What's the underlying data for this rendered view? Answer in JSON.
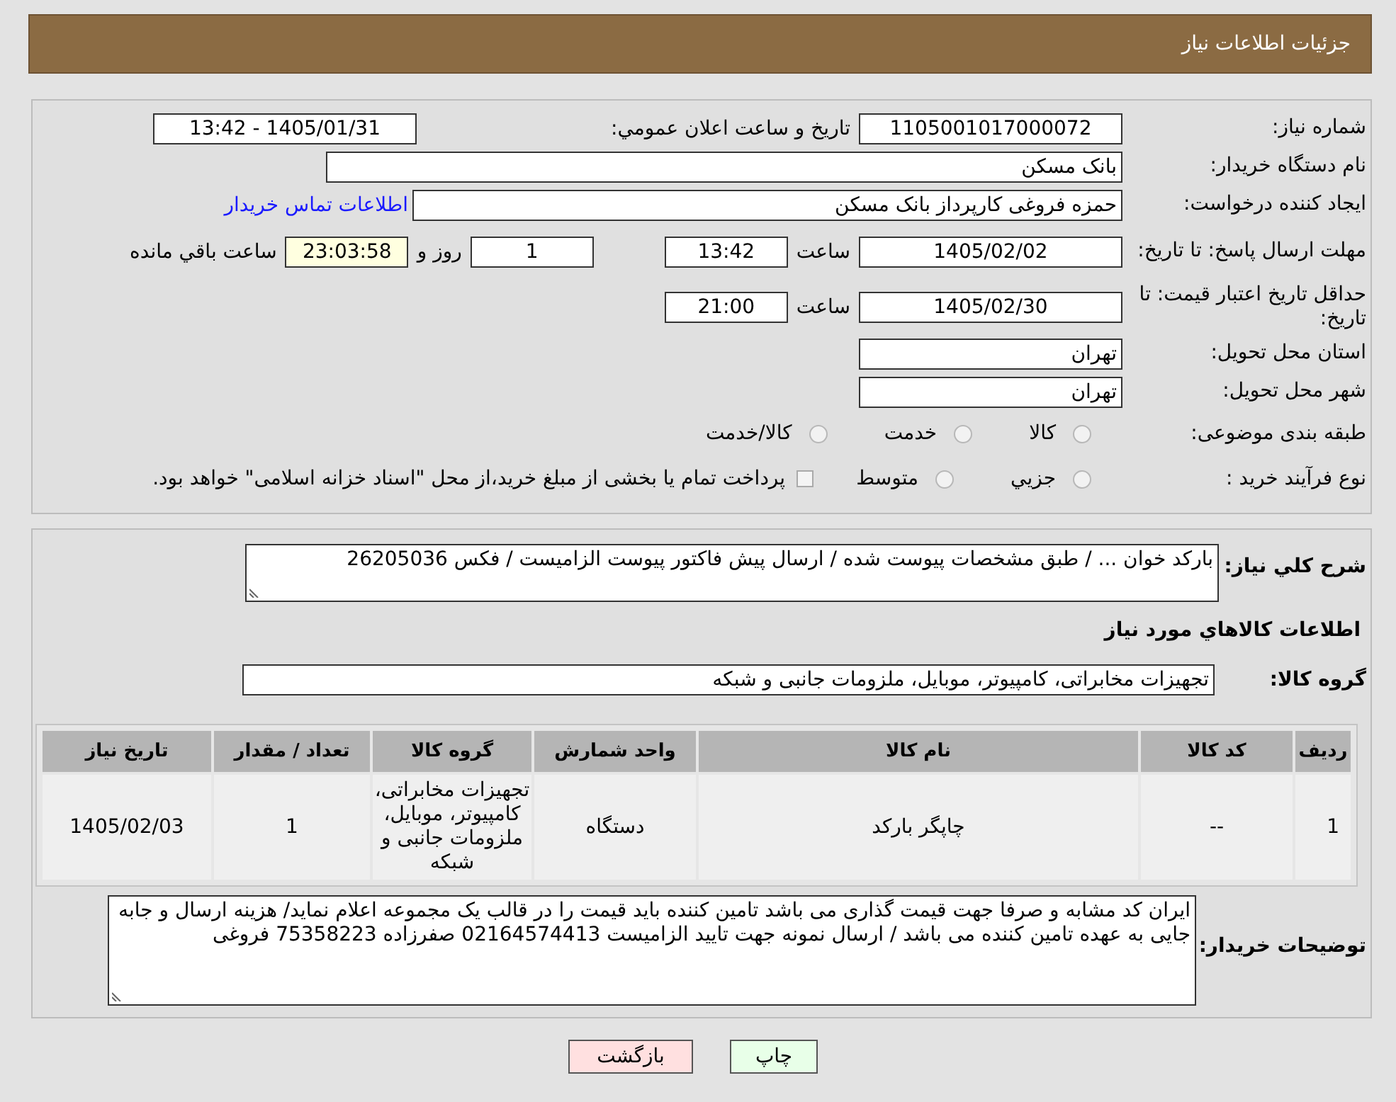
{
  "header": {
    "title": "جزئیات اطلاعات نیاز"
  },
  "need_number": {
    "label": "شماره نیاز:",
    "value": "1105001017000072"
  },
  "announce": {
    "label": "تاریخ و ساعت اعلان عمومي:",
    "value": "1405/01/31 - 13:42"
  },
  "buyer_org": {
    "label": "نام دستگاه خریدار:",
    "value": "بانک مسکن"
  },
  "requester": {
    "label": "ایجاد کننده درخواست:",
    "value": "حمزه فروغی کارپرداز بانک مسکن",
    "link": "اطلاعات تماس خریدار"
  },
  "response_deadline": {
    "label": "مهلت ارسال پاسخ: تا تاریخ:",
    "date": "1405/02/02",
    "time_label": "ساعت",
    "time": "13:42",
    "days": "1",
    "days_label": "روز و",
    "remaining": "23:03:58",
    "remaining_label": "ساعت باقي مانده"
  },
  "price_validity": {
    "label": "حداقل تاریخ اعتبار قیمت: تا تاریخ:",
    "date": "1405/02/30",
    "time_label": "ساعت",
    "time": "21:00"
  },
  "province": {
    "label": "استان محل تحویل:",
    "value": "تهران"
  },
  "city": {
    "label": "شهر محل تحویل:",
    "value": "تهران"
  },
  "category": {
    "label": "طبقه بندی موضوعی:",
    "options": [
      {
        "label": "کالا",
        "selected": false
      },
      {
        "label": "خدمت",
        "selected": false
      },
      {
        "label": "کالا/خدمت",
        "selected": false
      }
    ]
  },
  "purchase_type": {
    "label": "نوع فرآیند خرید :",
    "options": [
      {
        "label": "جزيي",
        "selected": false
      },
      {
        "label": "متوسط",
        "selected": false
      }
    ],
    "note": {
      "checked": false,
      "text": "پرداخت تمام یا بخشی از مبلغ خرید،از محل \"اسناد خزانه اسلامی\" خواهد بود."
    }
  },
  "description": {
    "label": "شرح کلي نیاز:",
    "value": "بارکد خوان  ... / طبق مشخصات پیوست شده / ارسال پیش فاکتور پیوست الزامیست / فکس 26205036"
  },
  "goods_heading": "اطلاعات کالاهاي مورد نیاز",
  "goods_group": {
    "label": "گروه کالا:",
    "value": "تجهیزات مخابراتی، کامپیوتر، موبایل، ملزومات جانبی و شبکه"
  },
  "table": {
    "columns": [
      "ردیف",
      "کد کالا",
      "نام کالا",
      "واحد شمارش",
      "گروه کالا",
      "تعداد / مقدار",
      "تاریخ نیاز"
    ],
    "rows": [
      [
        "1",
        "--",
        "چاپگر بارکد",
        "دستگاه",
        "تجهیزات مخابراتی، کامپیوتر، موبایل، ملزومات جانبی و شبکه",
        "1",
        "1405/02/03"
      ]
    ]
  },
  "buyer_notes": {
    "label": "توضیحات خریدار:",
    "value": "ایران کد مشابه و صرفا جهت قیمت گذاری می باشد تامین کننده باید قیمت را در قالب یک مجموعه اعلام نماید/ هزینه ارسال و جابه جایی به عهده تامین کننده می باشد / ارسال نمونه جهت تایید الزامیست 02164574413 صفرزاده 75358223 فروغی"
  },
  "buttons": [
    {
      "label": "چاپ",
      "kind": "print"
    },
    {
      "label": "بازگشت",
      "kind": "back"
    }
  ]
}
